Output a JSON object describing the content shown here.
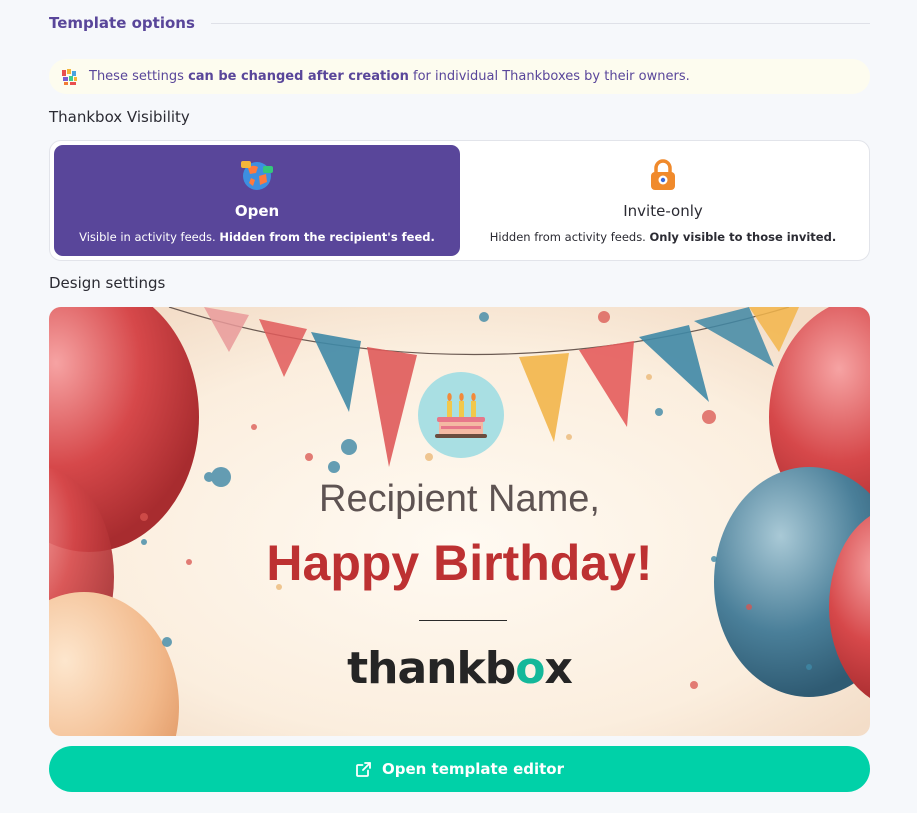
{
  "header": {
    "title": "Template options"
  },
  "notice": {
    "text_before": "These settings ",
    "text_bold": "can be changed after creation",
    "text_after": " for individual Thankboxes by their owners.",
    "icon": "colorful-blocks-icon"
  },
  "visibility": {
    "label": "Thankbox Visibility",
    "selected": "open",
    "options": [
      {
        "id": "open",
        "title": "Open",
        "desc_plain": "Visible in activity feeds. ",
        "desc_bold": "Hidden from the recipient's feed.",
        "icon": "globe-icon"
      },
      {
        "id": "invite-only",
        "title": "Invite-only",
        "desc_plain": "Hidden from activity feeds. ",
        "desc_bold": "Only visible to those invited.",
        "icon": "lock-icon"
      }
    ]
  },
  "design": {
    "label": "Design settings",
    "banner": {
      "recipient": "Recipient Name,",
      "greeting": "Happy Birthday!",
      "brand_prefix": "thankb",
      "brand_heart": "o",
      "brand_suffix": "x"
    }
  },
  "editor_button": {
    "label": "Open template editor",
    "icon": "external-link-icon"
  },
  "colors": {
    "accent": "#59469a",
    "button": "#00d1a8",
    "greeting": "#bd3132",
    "brand_heart": "#14b89a"
  }
}
